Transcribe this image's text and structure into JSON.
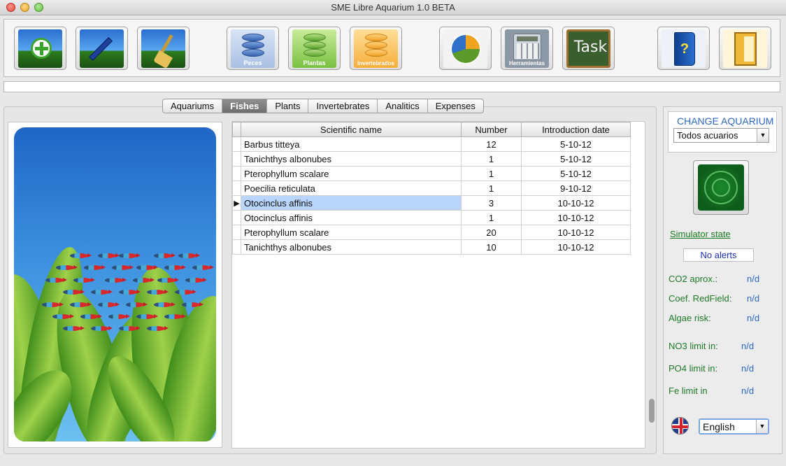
{
  "window": {
    "title": "SME Libre Aquarium 1.0 BETA"
  },
  "toolbar": {
    "buttons": [
      {
        "id": "add-aquarium",
        "caption": ""
      },
      {
        "id": "edit-aquarium",
        "caption": ""
      },
      {
        "id": "clean-aquarium",
        "caption": ""
      },
      {
        "id": "fishes",
        "caption": "Peces"
      },
      {
        "id": "plants",
        "caption": "Plantas"
      },
      {
        "id": "invertebrates",
        "caption": "Invertebrados"
      },
      {
        "id": "statistics",
        "caption": "Estadísticas"
      },
      {
        "id": "tools",
        "caption": "Herramientas"
      },
      {
        "id": "task",
        "caption": "Task"
      },
      {
        "id": "help",
        "caption": "?"
      },
      {
        "id": "exit",
        "caption": ""
      }
    ]
  },
  "tabs": [
    {
      "label": "Aquariums",
      "active": false
    },
    {
      "label": "Fishes",
      "active": true
    },
    {
      "label": "Plants",
      "active": false
    },
    {
      "label": "Invertebrates",
      "active": false
    },
    {
      "label": "Analitics",
      "active": false
    },
    {
      "label": "Expenses",
      "active": false
    }
  ],
  "table": {
    "columns": [
      "Scientific name",
      "Number",
      "Introduction date"
    ],
    "rows": [
      {
        "name": "Barbus titteya",
        "number": "12",
        "date": "5-10-12",
        "selected": false
      },
      {
        "name": "Tanichthys albonubes",
        "number": "1",
        "date": "5-10-12",
        "selected": false
      },
      {
        "name": "Pterophyllum scalare",
        "number": "1",
        "date": "5-10-12",
        "selected": false
      },
      {
        "name": "Poecilia reticulata",
        "number": "1",
        "date": "9-10-12",
        "selected": false
      },
      {
        "name": "Otocinclus affinis",
        "number": "3",
        "date": "10-10-12",
        "selected": true
      },
      {
        "name": "Otocinclus affinis",
        "number": "1",
        "date": "10-10-12",
        "selected": false
      },
      {
        "name": "Pterophyllum scalare",
        "number": "20",
        "date": "10-10-12",
        "selected": false
      },
      {
        "name": "Tanichthys albonubes",
        "number": "10",
        "date": "10-10-12",
        "selected": false
      }
    ]
  },
  "sidebar": {
    "change_title": "CHANGE AQUARIUM",
    "aquarium_select": "Todos acuarios",
    "simulator_link": "Simulator state",
    "alerts": "No alerts",
    "params": [
      {
        "label": "CO2 aprox.:",
        "value": "n/d"
      },
      {
        "label": "Coef. RedField:",
        "value": "n/d"
      },
      {
        "label": "Algae risk:",
        "value": "n/d"
      },
      {
        "label": "NO3 limit in:",
        "value": "n/d"
      },
      {
        "label": "PO4 limit in:",
        "value": "n/d"
      },
      {
        "label": "Fe limit in",
        "value": "n/d"
      }
    ],
    "language": "English"
  },
  "colors": {
    "accent_blue": "#2c66c4",
    "param_green": "#207a2a",
    "selection": "#b9d5fb"
  }
}
